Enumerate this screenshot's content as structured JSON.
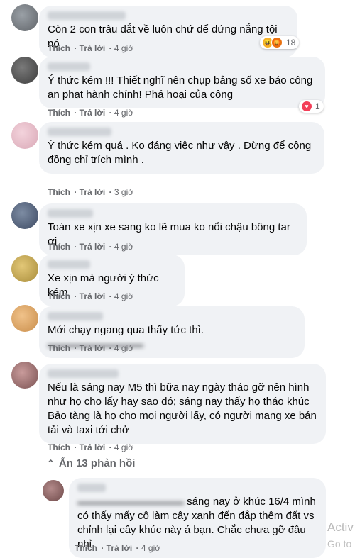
{
  "actions": {
    "like": "Thích",
    "reply": "Trả lời"
  },
  "comments": [
    {
      "text": "Còn 2 con trâu dắt về luôn chứ để đứng nắng tội nó",
      "time": "4 giờ",
      "reaction_count": "18"
    },
    {
      "text": "Ý thức kém !!! Thiết nghĩ nên chụp bảng số xe báo công an phạt hành chính! Phá hoại của công",
      "time": "4 giờ",
      "reaction_count": "1"
    },
    {
      "text": "Ý thức kém quá . Ko đáng việc như vậy . Đừng để cộng đồng chỉ trích mình .",
      "time": "3 giờ"
    },
    {
      "text": "Toàn xe xịn xe sang ko lẽ mua ko nổi chậu bông tar ơi",
      "time": "4 giờ"
    },
    {
      "text": "Xe xịn mà người ý thức kém",
      "time": "4 giờ"
    },
    {
      "text": "Mới chạy ngang qua thấy tức thì.",
      "time": "4 giờ"
    },
    {
      "text": "Nếu là sáng nay M5 thì bữa nay ngày tháo gỡ nên hình như họ cho lấy hay sao đó; sáng nay thấy họ tháo khúc Bảo tàng là họ cho mọi người lấy, có người mang xe bán tải và taxi tới chở",
      "time": "4 giờ"
    }
  ],
  "replies_toggle": "Ẩn 13 phản hồi",
  "reply": {
    "text": "sáng nay ở khúc 16/4 mình có thấy mấy cô làm cây xanh đến đắp thêm đất vs chỉnh lại cây khúc này á bạn. Chắc chưa gỡ đâu nhỉ",
    "time": "4 giờ"
  },
  "watermark": {
    "line1": "Activ",
    "line2": "Go to"
  },
  "colors": {
    "bubble": "#f0f2f5",
    "meta": "#65676b",
    "text": "#050505",
    "heart": "#f33e58",
    "haha": "#f7b125"
  },
  "icons": {
    "reaction_1": [
      "haha-icon",
      "angry-icon"
    ],
    "reaction_2": [
      "heart-icon"
    ],
    "toggle": "chevron-up-icon"
  }
}
